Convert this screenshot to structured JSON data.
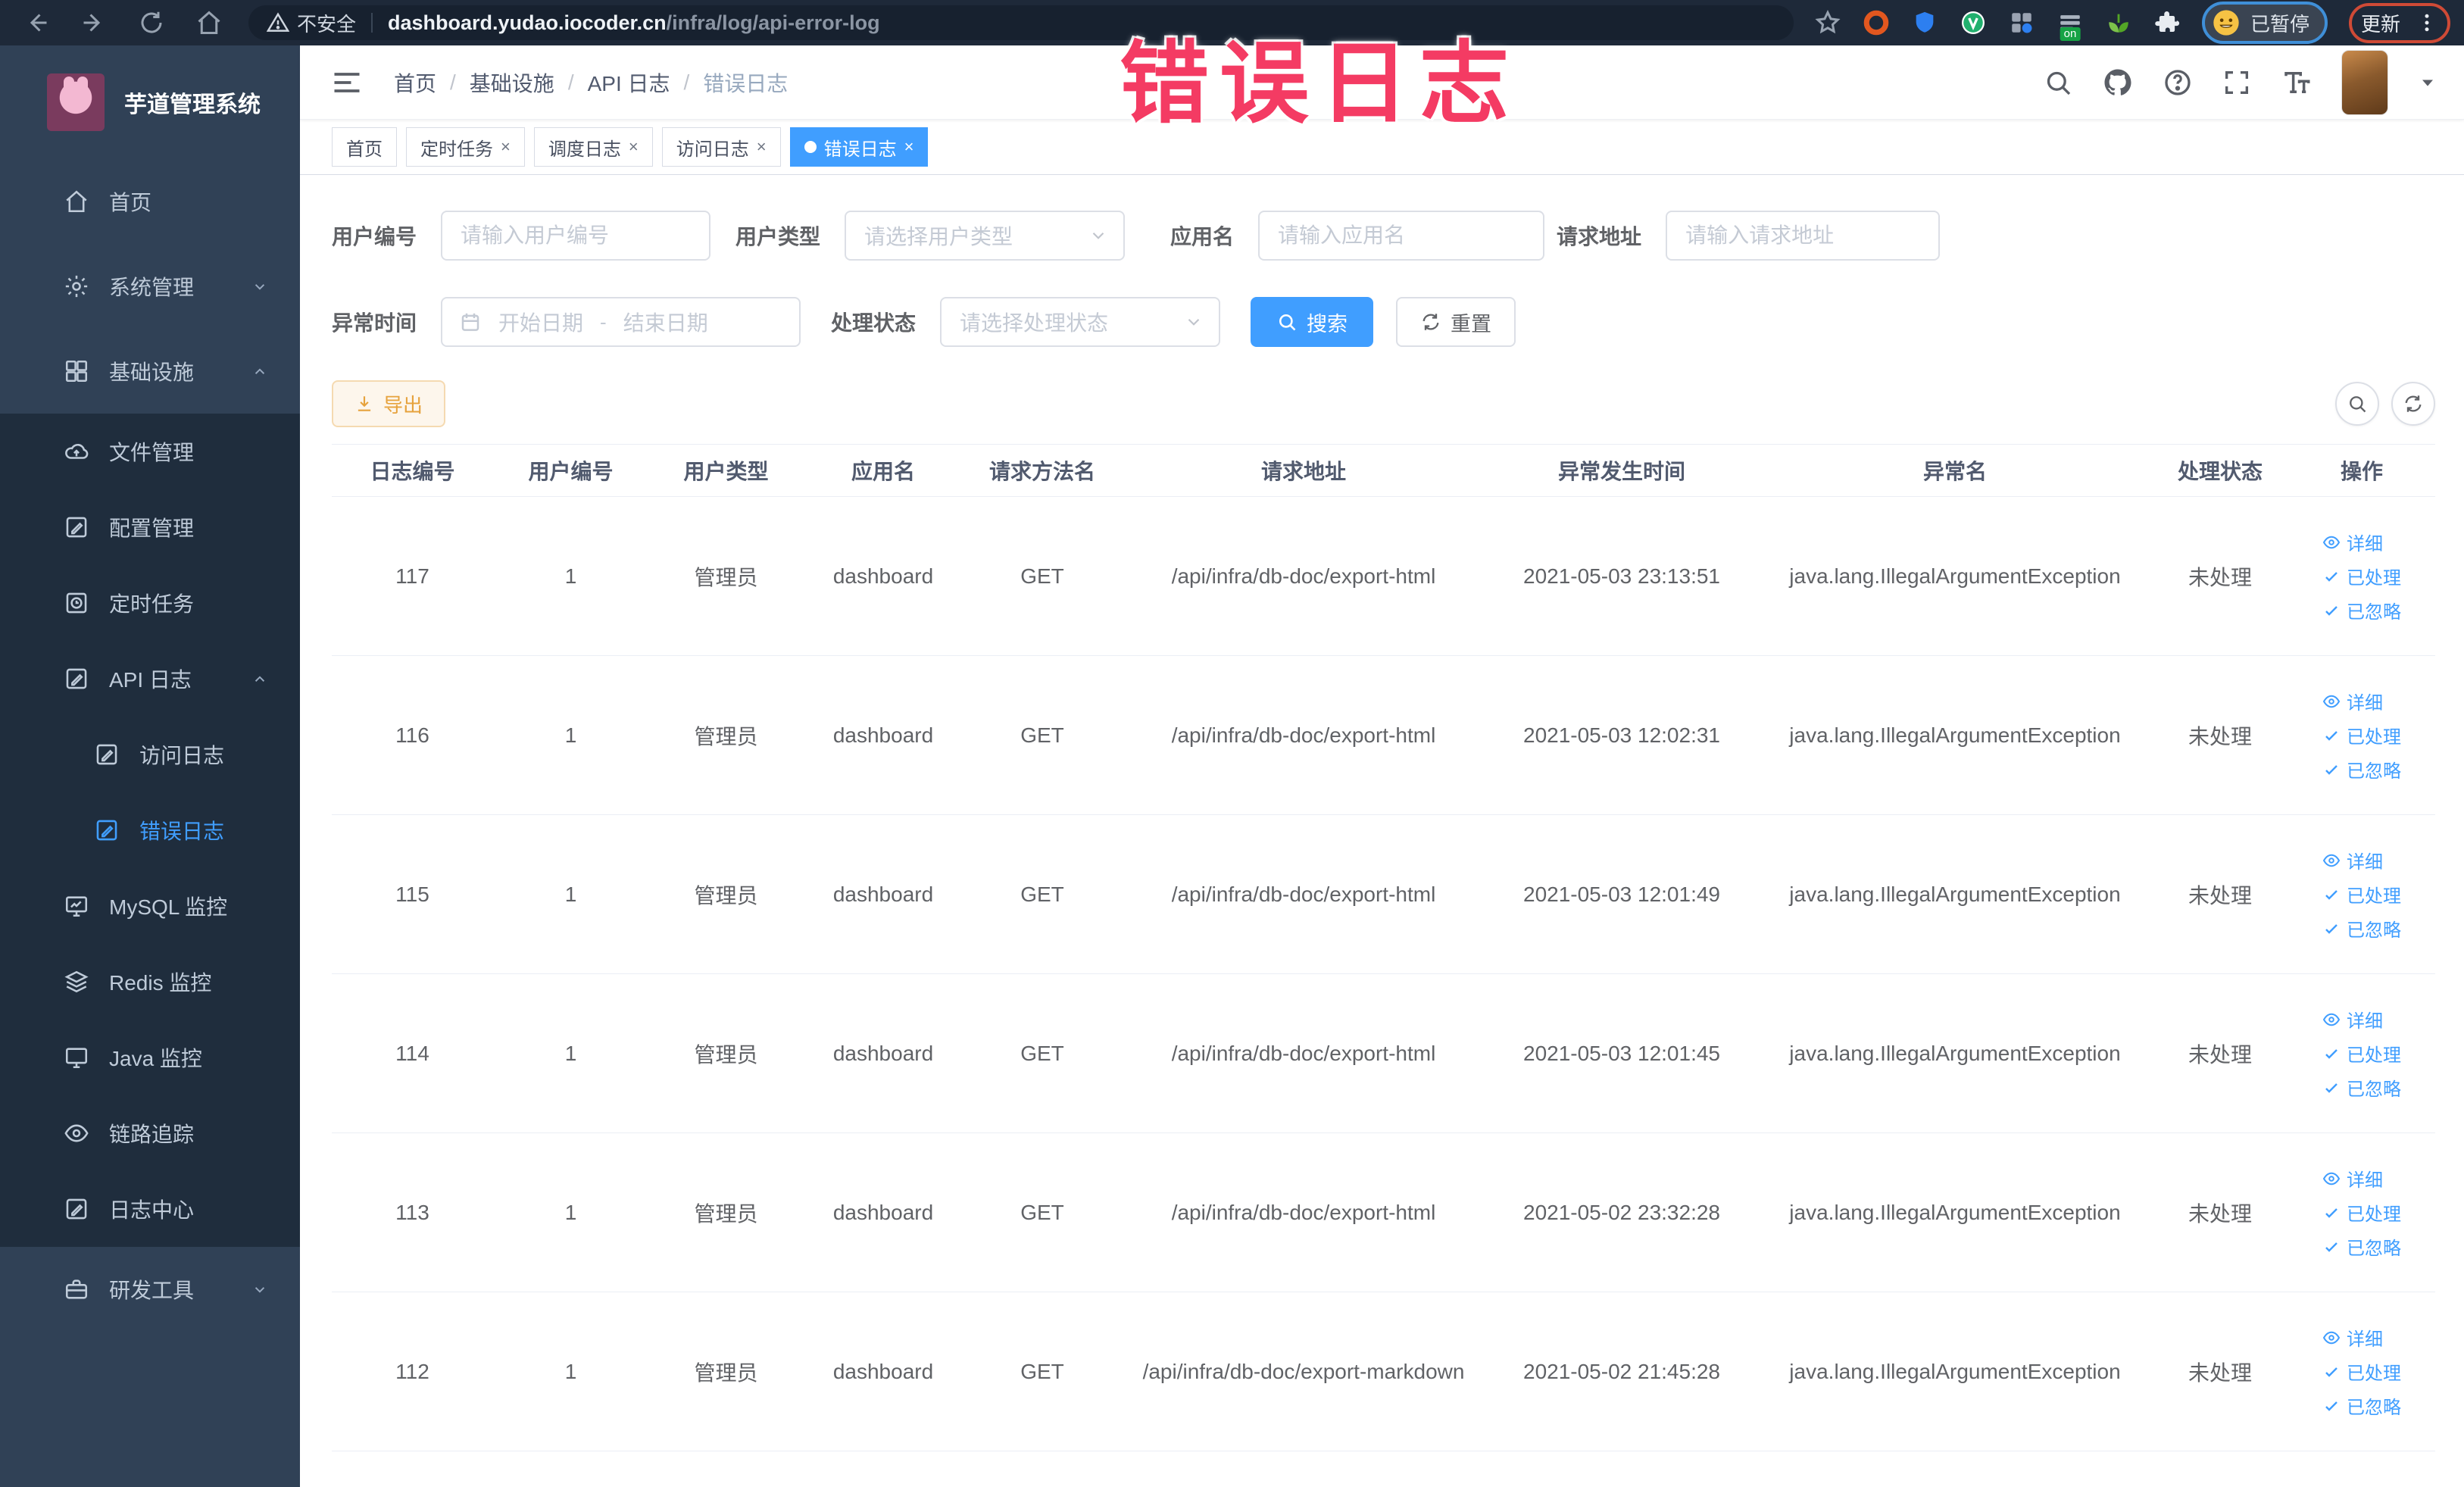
{
  "browser": {
    "security_label": "不安全",
    "url_host": "dashboard.yudao.iocoder.cn",
    "url_path": "/infra/log/api-error-log",
    "profile_label": "已暂停",
    "update_label": "更新",
    "extensions": [
      {
        "name": "ext-ring",
        "color": "#e2571f"
      },
      {
        "name": "ext-shield",
        "color": "#2d7ff0"
      },
      {
        "name": "ext-circle-v",
        "color": "#21b06e"
      },
      {
        "name": "ext-grid",
        "color": "#9aa3b2",
        "dot_color": "#2d7ff0"
      },
      {
        "name": "ext-rows",
        "color": "#343f4e",
        "badge": "on",
        "badge_color": "#17a345"
      },
      {
        "name": "ext-leaf",
        "color": "#53a626"
      }
    ]
  },
  "annotation": {
    "text": "错误日志",
    "color": "#f43b63"
  },
  "sidebar": {
    "logo_title": "芋道管理系统",
    "items": [
      {
        "label": "首页",
        "icon": "home-icon",
        "type": "top"
      },
      {
        "label": "系统管理",
        "icon": "gear-icon",
        "type": "top",
        "chevron": "down"
      },
      {
        "label": "基础设施",
        "icon": "grid-icon",
        "type": "top",
        "chevron": "up"
      },
      {
        "label": "文件管理",
        "icon": "cloud-icon",
        "type": "sub"
      },
      {
        "label": "配置管理",
        "icon": "edit-icon",
        "type": "sub"
      },
      {
        "label": "定时任务",
        "icon": "clock-icon",
        "type": "sub"
      },
      {
        "label": "API 日志",
        "icon": "edit-icon",
        "type": "sub",
        "chevron": "up"
      },
      {
        "label": "访问日志",
        "icon": "edit-icon",
        "type": "sub2"
      },
      {
        "label": "错误日志",
        "icon": "edit-icon",
        "type": "sub2",
        "active": true
      },
      {
        "label": "MySQL 监控",
        "icon": "monitor-chart-icon",
        "type": "sub"
      },
      {
        "label": "Redis 监控",
        "icon": "layers-icon",
        "type": "sub"
      },
      {
        "label": "Java 监控",
        "icon": "monitor-icon",
        "type": "sub"
      },
      {
        "label": "链路追踪",
        "icon": "eye-icon",
        "type": "sub"
      },
      {
        "label": "日志中心",
        "icon": "edit-icon",
        "type": "sub"
      },
      {
        "label": "研发工具",
        "icon": "toolbox-icon",
        "type": "top",
        "chevron": "down"
      }
    ]
  },
  "breadcrumb": [
    "首页",
    "基础设施",
    "API 日志",
    "错误日志"
  ],
  "tabs": [
    {
      "label": "首页",
      "closable": false,
      "active": false
    },
    {
      "label": "定时任务",
      "closable": true,
      "active": false
    },
    {
      "label": "调度日志",
      "closable": true,
      "active": false
    },
    {
      "label": "访问日志",
      "closable": true,
      "active": false
    },
    {
      "label": "错误日志",
      "closable": true,
      "active": true
    }
  ],
  "filters": {
    "user_id": {
      "label": "用户编号",
      "placeholder": "请输入用户编号"
    },
    "user_type": {
      "label": "用户类型",
      "placeholder": "请选择用户类型"
    },
    "app_name": {
      "label": "应用名",
      "placeholder": "请输入应用名"
    },
    "request_url": {
      "label": "请求地址",
      "placeholder": "请输入请求地址"
    },
    "exception_time": {
      "label": "异常时间",
      "start_placeholder": "开始日期",
      "separator": "-",
      "end_placeholder": "结束日期"
    },
    "process_status": {
      "label": "处理状态",
      "placeholder": "请选择处理状态"
    },
    "search_label": "搜索",
    "reset_label": "重置"
  },
  "toolbar": {
    "export_label": "导出"
  },
  "table": {
    "headers": [
      "日志编号",
      "用户编号",
      "用户类型",
      "应用名",
      "请求方法名",
      "请求地址",
      "异常发生时间",
      "异常名",
      "处理状态",
      "操作"
    ],
    "action_labels": [
      "详细",
      "已处理",
      "已忽略"
    ],
    "rows": [
      {
        "id": "117",
        "user_id": "1",
        "user_type": "管理员",
        "app": "dashboard",
        "method": "GET",
        "url": "/api/infra/db-doc/export-html",
        "time": "2021-05-03 23:13:51",
        "exception": "java.lang.IllegalArgumentException",
        "status": "未处理"
      },
      {
        "id": "116",
        "user_id": "1",
        "user_type": "管理员",
        "app": "dashboard",
        "method": "GET",
        "url": "/api/infra/db-doc/export-html",
        "time": "2021-05-03 12:02:31",
        "exception": "java.lang.IllegalArgumentException",
        "status": "未处理"
      },
      {
        "id": "115",
        "user_id": "1",
        "user_type": "管理员",
        "app": "dashboard",
        "method": "GET",
        "url": "/api/infra/db-doc/export-html",
        "time": "2021-05-03 12:01:49",
        "exception": "java.lang.IllegalArgumentException",
        "status": "未处理"
      },
      {
        "id": "114",
        "user_id": "1",
        "user_type": "管理员",
        "app": "dashboard",
        "method": "GET",
        "url": "/api/infra/db-doc/export-html",
        "time": "2021-05-03 12:01:45",
        "exception": "java.lang.IllegalArgumentException",
        "status": "未处理"
      },
      {
        "id": "113",
        "user_id": "1",
        "user_type": "管理员",
        "app": "dashboard",
        "method": "GET",
        "url": "/api/infra/db-doc/export-html",
        "time": "2021-05-02 23:32:28",
        "exception": "java.lang.IllegalArgumentException",
        "status": "未处理"
      },
      {
        "id": "112",
        "user_id": "1",
        "user_type": "管理员",
        "app": "dashboard",
        "method": "GET",
        "url": "/api/infra/db-doc/export-markdown",
        "time": "2021-05-02 21:45:28",
        "exception": "java.lang.IllegalArgumentException",
        "status": "未处理"
      }
    ]
  }
}
